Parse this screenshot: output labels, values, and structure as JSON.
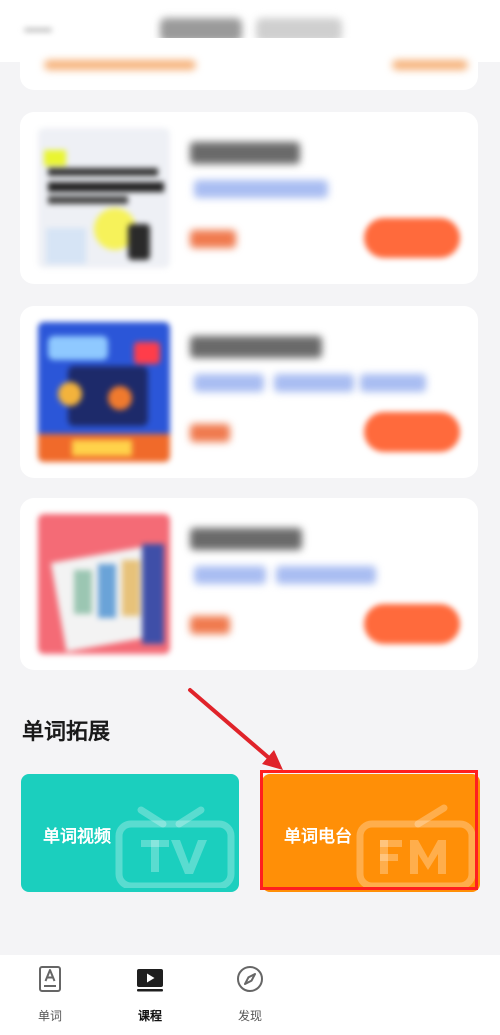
{
  "section": {
    "title": "单词拓展"
  },
  "extensions": [
    {
      "label": "单词视频",
      "color": "#1bcfbe",
      "icon": "tv-icon"
    },
    {
      "label": "单词电台",
      "color": "#ff8f07",
      "icon": "fm-radio-icon"
    }
  ],
  "tabbar": {
    "items": [
      {
        "label": "单词",
        "icon": "word-book-icon",
        "active": false
      },
      {
        "label": "课程",
        "icon": "play-icon",
        "active": true
      },
      {
        "label": "发现",
        "icon": "compass-icon",
        "active": false
      }
    ]
  },
  "colors": {
    "accent_orange": "#ff6a3c",
    "highlight_red": "#ff1f1f",
    "background": "#f4f4f6"
  }
}
